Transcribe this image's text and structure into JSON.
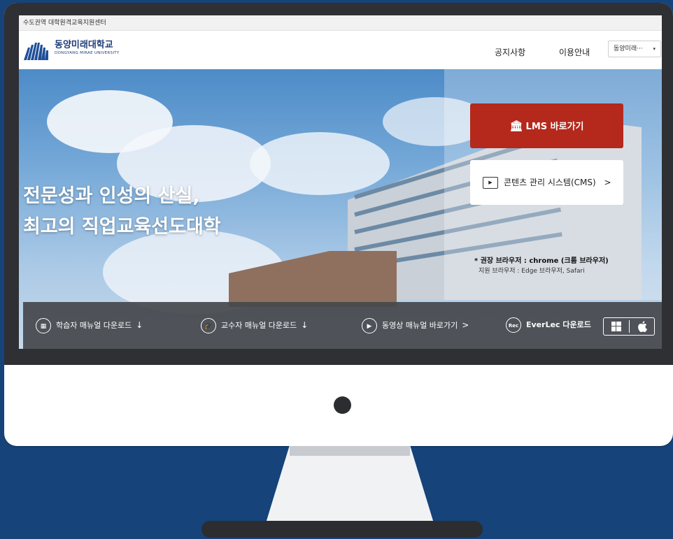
{
  "topbar": {
    "text": "수도권역 대학원격교육지원센터"
  },
  "header": {
    "logo_kr": "동양미래대학교",
    "logo_en": "DONGYANG MIRAE UNIVERSITY",
    "nav": {
      "notice": "공지사항",
      "guide": "이용안내"
    },
    "select": {
      "value": "동양미래···",
      "caret": "▾"
    }
  },
  "hero": {
    "title_line1": "전문성과 인성의 산실,",
    "title_line2": "최고의 직업교육선도대학",
    "lms_label": "LMS 바로가기",
    "cms_label": "콘텐츠 관리 시스템(CMS)",
    "cms_arrow": ">",
    "browser": {
      "rec_prefix": "* 권장 브라우저 : ",
      "rec_value": "chrome (크롬 브라우저)",
      "supported": "지원 브라우저 : Edge 브라우저, Safari"
    }
  },
  "bottom": {
    "items": [
      {
        "label": "학습자 매뉴얼 다운로드",
        "arrow": "↓"
      },
      {
        "label": "교수자 매뉴얼 다운로드",
        "arrow": "↓"
      },
      {
        "label": "동영상 매뉴얼 바로가기",
        "arrow": ">"
      },
      {
        "label": "EverLec 다운로드",
        "rec": "Rec"
      }
    ]
  },
  "colors": {
    "accent": "#b4291c",
    "background": "#15437a",
    "bar": "#46484c"
  }
}
